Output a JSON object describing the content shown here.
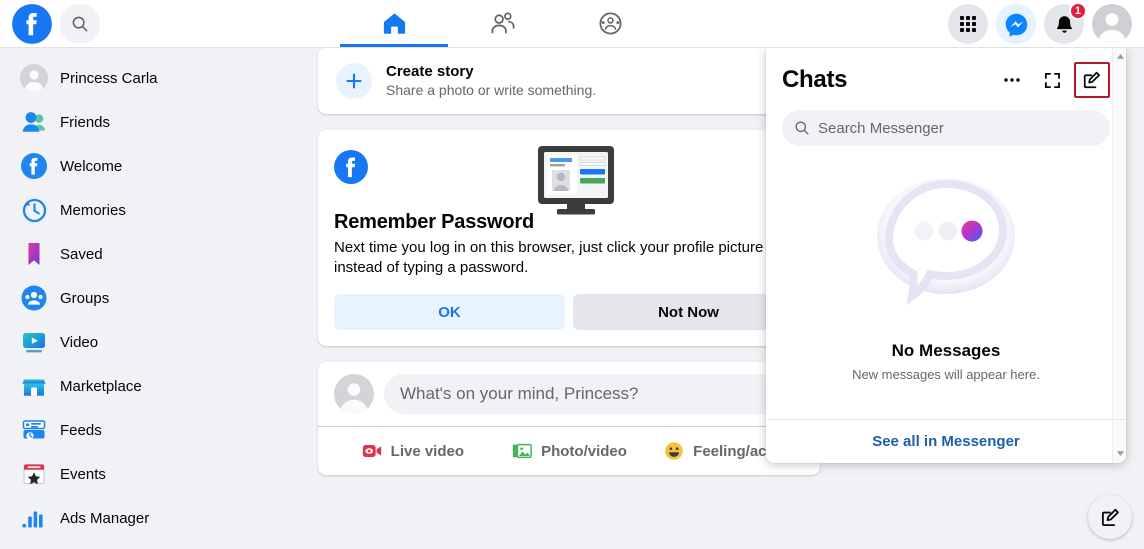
{
  "topbar": {
    "logo_icon": "facebook-logo-icon",
    "search_icon": "search-icon",
    "tabs": [
      {
        "name": "home",
        "icon": "home-icon",
        "active": true
      },
      {
        "name": "friends",
        "icon": "friends-icon",
        "active": false
      },
      {
        "name": "groups",
        "icon": "groups-icon",
        "active": false
      }
    ],
    "right": {
      "menu_icon": "grid-menu-icon",
      "messenger_icon": "messenger-icon",
      "notifications_icon": "bell-icon",
      "notifications_count": "1",
      "account_icon": "account-avatar-icon"
    }
  },
  "sidebar": {
    "items": [
      {
        "label": "Princess Carla",
        "icon": "profile-avatar-icon"
      },
      {
        "label": "Friends",
        "icon": "friends-icon"
      },
      {
        "label": "Welcome",
        "icon": "facebook-welcome-icon"
      },
      {
        "label": "Memories",
        "icon": "memories-clock-icon"
      },
      {
        "label": "Saved",
        "icon": "saved-bookmark-icon"
      },
      {
        "label": "Groups",
        "icon": "groups-icon"
      },
      {
        "label": "Video",
        "icon": "video-play-icon"
      },
      {
        "label": "Marketplace",
        "icon": "marketplace-store-icon"
      },
      {
        "label": "Feeds",
        "icon": "feeds-icon"
      },
      {
        "label": "Events",
        "icon": "events-calendar-icon"
      },
      {
        "label": "Ads Manager",
        "icon": "ads-manager-bars-icon"
      }
    ]
  },
  "feed": {
    "create_story": {
      "plus_icon": "plus-icon",
      "title": "Create story",
      "subtitle": "Share a photo or write something."
    },
    "remember_password": {
      "brand_icon": "facebook-logo-icon",
      "illustration_icon": "monitor-login-illustration-icon",
      "title": "Remember Password",
      "body": "Next time you log in on this browser, just click your profile picture instead of typing a password.",
      "ok_label": "OK",
      "not_now_label": "Not Now"
    },
    "composer": {
      "avatar_icon": "profile-avatar-icon",
      "placeholder": "What's on your mind, Princess?",
      "actions": [
        {
          "label": "Live video",
          "icon": "live-video-icon"
        },
        {
          "label": "Photo/video",
          "icon": "photo-video-icon"
        },
        {
          "label": "Feeling/acti...",
          "icon": "feeling-activity-icon"
        }
      ]
    }
  },
  "chat_panel": {
    "title": "Chats",
    "options_icon": "ellipsis-icon",
    "expand_icon": "expand-icon",
    "compose_icon": "compose-new-message-icon",
    "compose_highlight_color": "#b01c28",
    "search_icon": "search-icon",
    "search_placeholder": "Search Messenger",
    "empty_illustration_icon": "speech-bubble-illustration-icon",
    "empty_title": "No Messages",
    "empty_subtitle": "New messages will appear here.",
    "footer_link": "See all in Messenger",
    "scroll_up_icon": "scroll-up-arrow-icon",
    "scroll_down_icon": "scroll-down-arrow-icon"
  },
  "fab": {
    "icon": "compose-new-message-icon"
  },
  "colors": {
    "brand_blue": "#1877f2",
    "page_background": "#f0f2f5",
    "card_background": "#ffffff",
    "secondary_text": "#65676b",
    "badge_red": "#e41e3f",
    "link_blue": "#1b60a8"
  }
}
